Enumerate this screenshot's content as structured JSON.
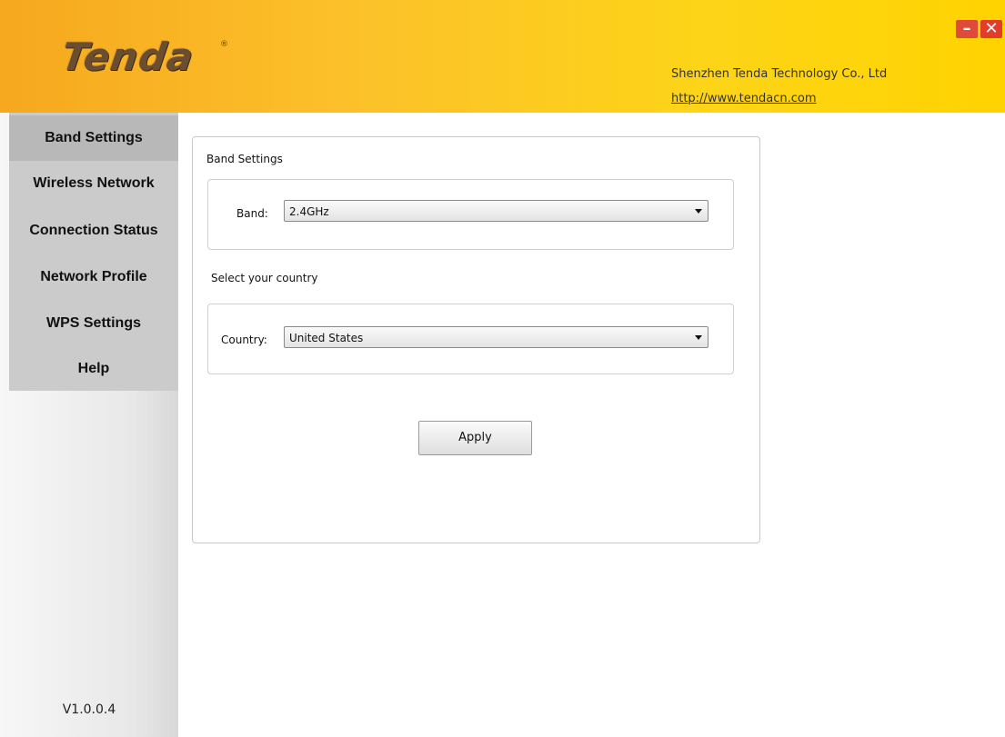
{
  "header": {
    "logo_text": "Tenda",
    "logo_reg": "®",
    "company": "Shenzhen Tenda Technology Co., Ltd",
    "url": "http://www.tendacn.com",
    "minimize_glyph": "–",
    "close_glyph": "✕",
    "accent_color": "#fdd418"
  },
  "sidebar": {
    "items": [
      {
        "label": "Band Settings",
        "active": true
      },
      {
        "label": "Wireless Network",
        "active": false
      },
      {
        "label": "Connection Status",
        "active": false
      },
      {
        "label": "Network Profile",
        "active": false
      },
      {
        "label": "WPS Settings",
        "active": false
      },
      {
        "label": "Help",
        "active": false
      }
    ],
    "version": "V1.0.0.4"
  },
  "main": {
    "band_section_title": "Band Settings",
    "band_label": "Band:",
    "band_value": "2.4GHz",
    "country_section_title": "Select your country",
    "country_label": "Country:",
    "country_value": "United States",
    "apply_label": "Apply"
  }
}
